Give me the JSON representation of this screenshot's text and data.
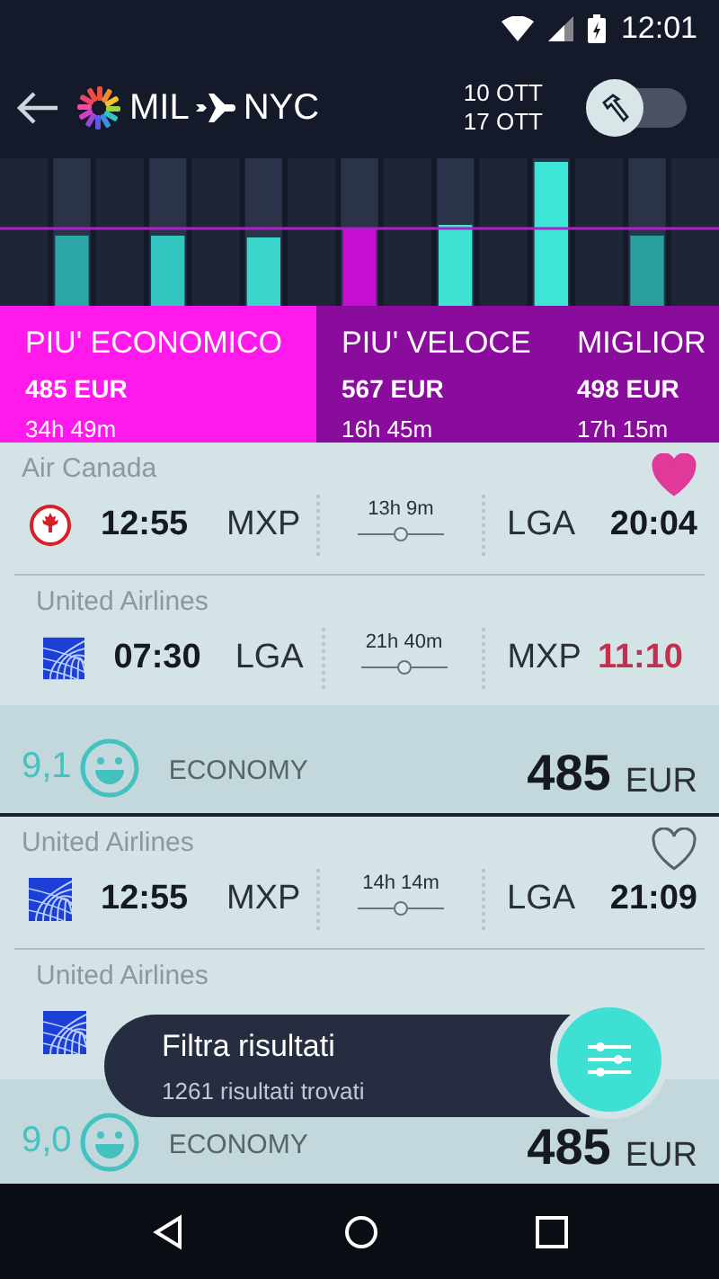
{
  "status_bar": {
    "time": "12:01"
  },
  "header": {
    "from": "MIL",
    "to": "NYC",
    "dates": [
      "10 OTT",
      "17 OTT"
    ],
    "toggle": {
      "on": false
    }
  },
  "tabs": [
    {
      "title": "PIU' ECONOMICO",
      "price": "485 EUR",
      "duration": "34h 49m",
      "selected": true
    },
    {
      "title": "PIU' VELOCE",
      "price": "567 EUR",
      "duration": "16h 45m",
      "selected": false
    },
    {
      "title": "MIGLIOR",
      "price": "498 EUR",
      "duration": "17h 15m",
      "selected": false
    }
  ],
  "results": [
    {
      "favorite": true,
      "legs": [
        {
          "airline": "Air Canada",
          "kind": "maple",
          "dep_time": "12:55",
          "dep_airport": "MXP",
          "duration": "13h 9m",
          "arr_airport": "LGA",
          "arr_time": "20:04",
          "next_day": false
        },
        {
          "airline": "United Airlines",
          "kind": "globe",
          "dep_time": "07:30",
          "dep_airport": "LGA",
          "duration": "21h 40m",
          "arr_airport": "MXP",
          "arr_time": "11:10",
          "next_day": true
        }
      ],
      "score": "9,1",
      "cabin": "ECONOMY",
      "price": "485",
      "currency": "EUR"
    },
    {
      "favorite": false,
      "legs": [
        {
          "airline": "United Airlines",
          "kind": "globe",
          "dep_time": "12:55",
          "dep_airport": "MXP",
          "duration": "14h 14m",
          "arr_airport": "LGA",
          "arr_time": "21:09",
          "next_day": false
        },
        {
          "airline": "United Airlines",
          "kind": "globe"
        }
      ],
      "score": "9,0",
      "cabin": "ECONOMY",
      "price": "485",
      "currency": "EUR"
    }
  ],
  "toast": {
    "title": "Filtra risultati",
    "subtitle": "1261 risultati trovati"
  }
}
